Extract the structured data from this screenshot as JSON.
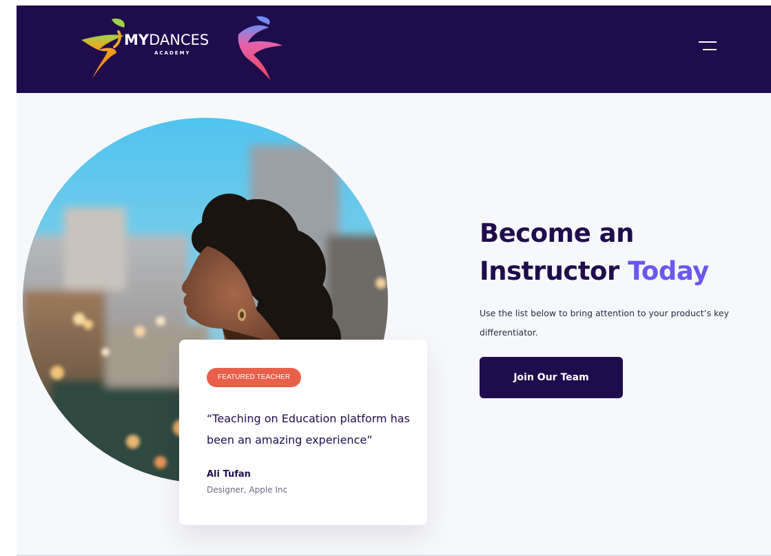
{
  "header": {
    "logo_text_bold": "MY",
    "logo_text_regular": "DANCES",
    "logo_subtitle": "ACADEMY",
    "menu_icon": "hamburger-menu-icon"
  },
  "hero": {
    "headline_part1": "Become an",
    "headline_part2": "Instructor",
    "headline_accent": "Today",
    "description": "Use the list below to bring attention to your product’s key differentiator.",
    "cta_label": "Join Our Team"
  },
  "featured_card": {
    "badge": "FEATURED TEACHER",
    "quote": "“Teaching on Education platform has been an amazing experience”",
    "author_name": "Ali Tufan",
    "author_role": "Designer, Apple Inc"
  },
  "colors": {
    "brand_dark": "#1f0c4d",
    "accent_purple": "#6d57f0",
    "badge_coral": "#e8604a",
    "page_bg": "#f7f8fb"
  }
}
